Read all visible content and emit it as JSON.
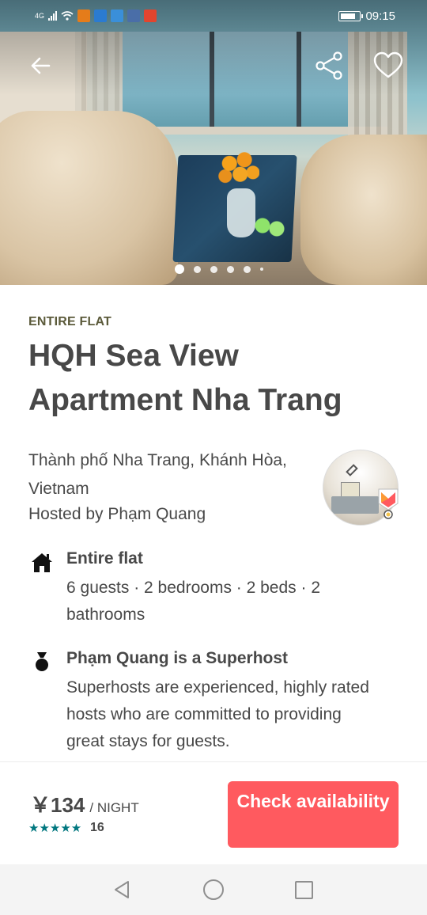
{
  "status_bar": {
    "network": "4G",
    "time": "09:15"
  },
  "hero": {
    "image_alt": "Living room with sea view",
    "photo_count_dots": 6,
    "active_dot": 0
  },
  "listing": {
    "kind": "ENTIRE FLAT",
    "title": "HQH Sea View Apartment Nha Trang",
    "location": "Thành phố Nha Trang, Khánh Hòa, Vietnam",
    "host_line": "Hosted by Phạm Quang"
  },
  "features": [
    {
      "icon": "home-icon",
      "title": "Entire flat",
      "description": "6 guests · 2 bedrooms · 2 beds · 2 bathrooms"
    },
    {
      "icon": "superhost-medal-icon",
      "title": "Phạm Quang is a Superhost",
      "description": "Superhosts are experienced, highly rated hosts who are committed to providing great stays for guests."
    }
  ],
  "booking": {
    "price": "￥134",
    "per": "/ NIGHT",
    "stars": "★★★★★",
    "review_count": "16",
    "cta_label": "Check availability"
  },
  "colors": {
    "accent": "#ff5a5f",
    "stars": "#00777f",
    "text": "#484848",
    "kind_label": "#5b5a3a"
  }
}
